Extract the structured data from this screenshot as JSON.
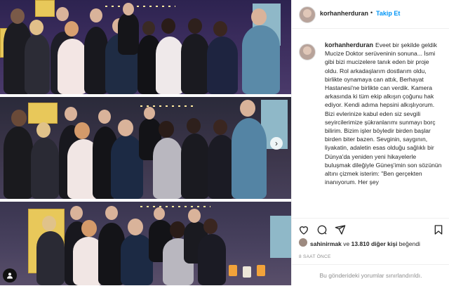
{
  "post": {
    "username": "korhanherduran",
    "follow_separator": "•",
    "follow_label": "Takip Et",
    "caption_username": "korhanherduran",
    "caption_text": "Eveet bir şekilde geldik Mucize Doktor serüveninin sonuna... İsmi gibi bizi mucizelere tanık eden bir proje oldu. Rol arkadaşlarım dostlarım oldu, birlikte oynamaya can attık, Berhayat Hastanesi'ne birlikte can verdik. Kamera arkasında ki tüm ekip alkışın çoğunu hak ediyor. Kendi adıma hepsini alkışlıyorum. Bizi evlerinize kabul eden siz sevgili seyircilerimize şükranlarımı sunmayı borç bilirim. Bizim işler böyledir birden başlar birden biter bazen. Sevginin, saygının, liyakatin, adaletin esas olduğu sağlıklı bir Dünya'da yeniden yeni hikayelerle buluşmak dileğiyle Güneş'imin son sözünün altını çizmek isterim: \"Ben gerçekten inanıyorum. Her şey",
    "likes_user": "sahinirmak",
    "likes_connector": "ve",
    "likes_count": "13.810 diğer kişi",
    "likes_suffix": "beğendi",
    "time_ago": "8 SAAT ÖNCE",
    "comments_disabled": "Bu gönderideki yorumlar sınırlandırıldı."
  },
  "icons": {
    "like": "heart-icon",
    "comment": "comment-icon",
    "share": "share-icon",
    "save": "bookmark-icon",
    "next": "chevron-right-icon",
    "tagged": "user-tag-icon"
  },
  "colors": {
    "accent": "#0095f6",
    "muted": "#8e8e8e",
    "border": "#efefef"
  }
}
